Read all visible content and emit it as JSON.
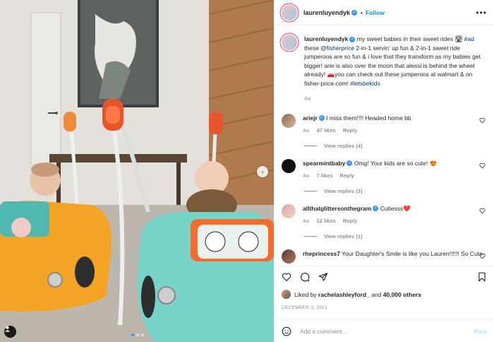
{
  "post": {
    "author": "laurenluyendyk",
    "follow_label": "Follow",
    "separator": "•",
    "more_label": "•••"
  },
  "caption": {
    "username": "laurenluyendyk",
    "text_parts": [
      "my sweet babies in their sweet rides 🛣 ",
      "#ad",
      " these ",
      "@fisherprice",
      " 2-in-1 servin' up fun & 2-in-1 sweet ride jumperoos are so fun & i love that they transform as my babies get bigger! arie is also over the moon that alessi is behind the wheel already! 🚗you can check out these jumperoos at walmart & on fisher-price.com! ",
      "#letsbekids"
    ],
    "time": "4w"
  },
  "comments": [
    {
      "username": "ariejr",
      "text": "I miss them!!!! Headed home bb",
      "time": "4w",
      "likes": "47 likes",
      "reply": "Reply",
      "view_replies": "View replies (4)"
    },
    {
      "username": "spearmintbaby",
      "text": "Omg! Your kids are so cute! 😍",
      "time": "4w",
      "likes": "7 likes",
      "reply": "Reply",
      "view_replies": "View replies (3)"
    },
    {
      "username": "allthatglittersonthegram",
      "text": "Cutiesss❤️",
      "time": "4w",
      "likes": "12 likes",
      "reply": "Reply",
      "view_replies": "View replies (1)"
    },
    {
      "username": "rheprincess7",
      "text": "Your Daughter's Smile is like you Lauren!!!!!! So Cute"
    }
  ],
  "likes": {
    "prefix": "Liked by ",
    "user": "rachelashleyford_",
    "middle": " and ",
    "others": "40,000 others"
  },
  "date": "DECEMBER 3, 2021",
  "add_comment": {
    "placeholder": "Add a comment...",
    "post_label": "Post"
  },
  "carousel": {
    "next_label": "›",
    "total": 3,
    "active_index": 1
  },
  "icons": {
    "like": "heart-icon",
    "comment": "comment-icon",
    "share": "share-icon",
    "save": "bookmark-icon",
    "emoji": "emoji-icon",
    "tag": "user-tag-icon"
  },
  "colors": {
    "link": "#00376b",
    "follow": "#0095f6",
    "verified": "#3897f0",
    "muted": "#8e8e8e",
    "post_disabled": "#b2dffc"
  }
}
